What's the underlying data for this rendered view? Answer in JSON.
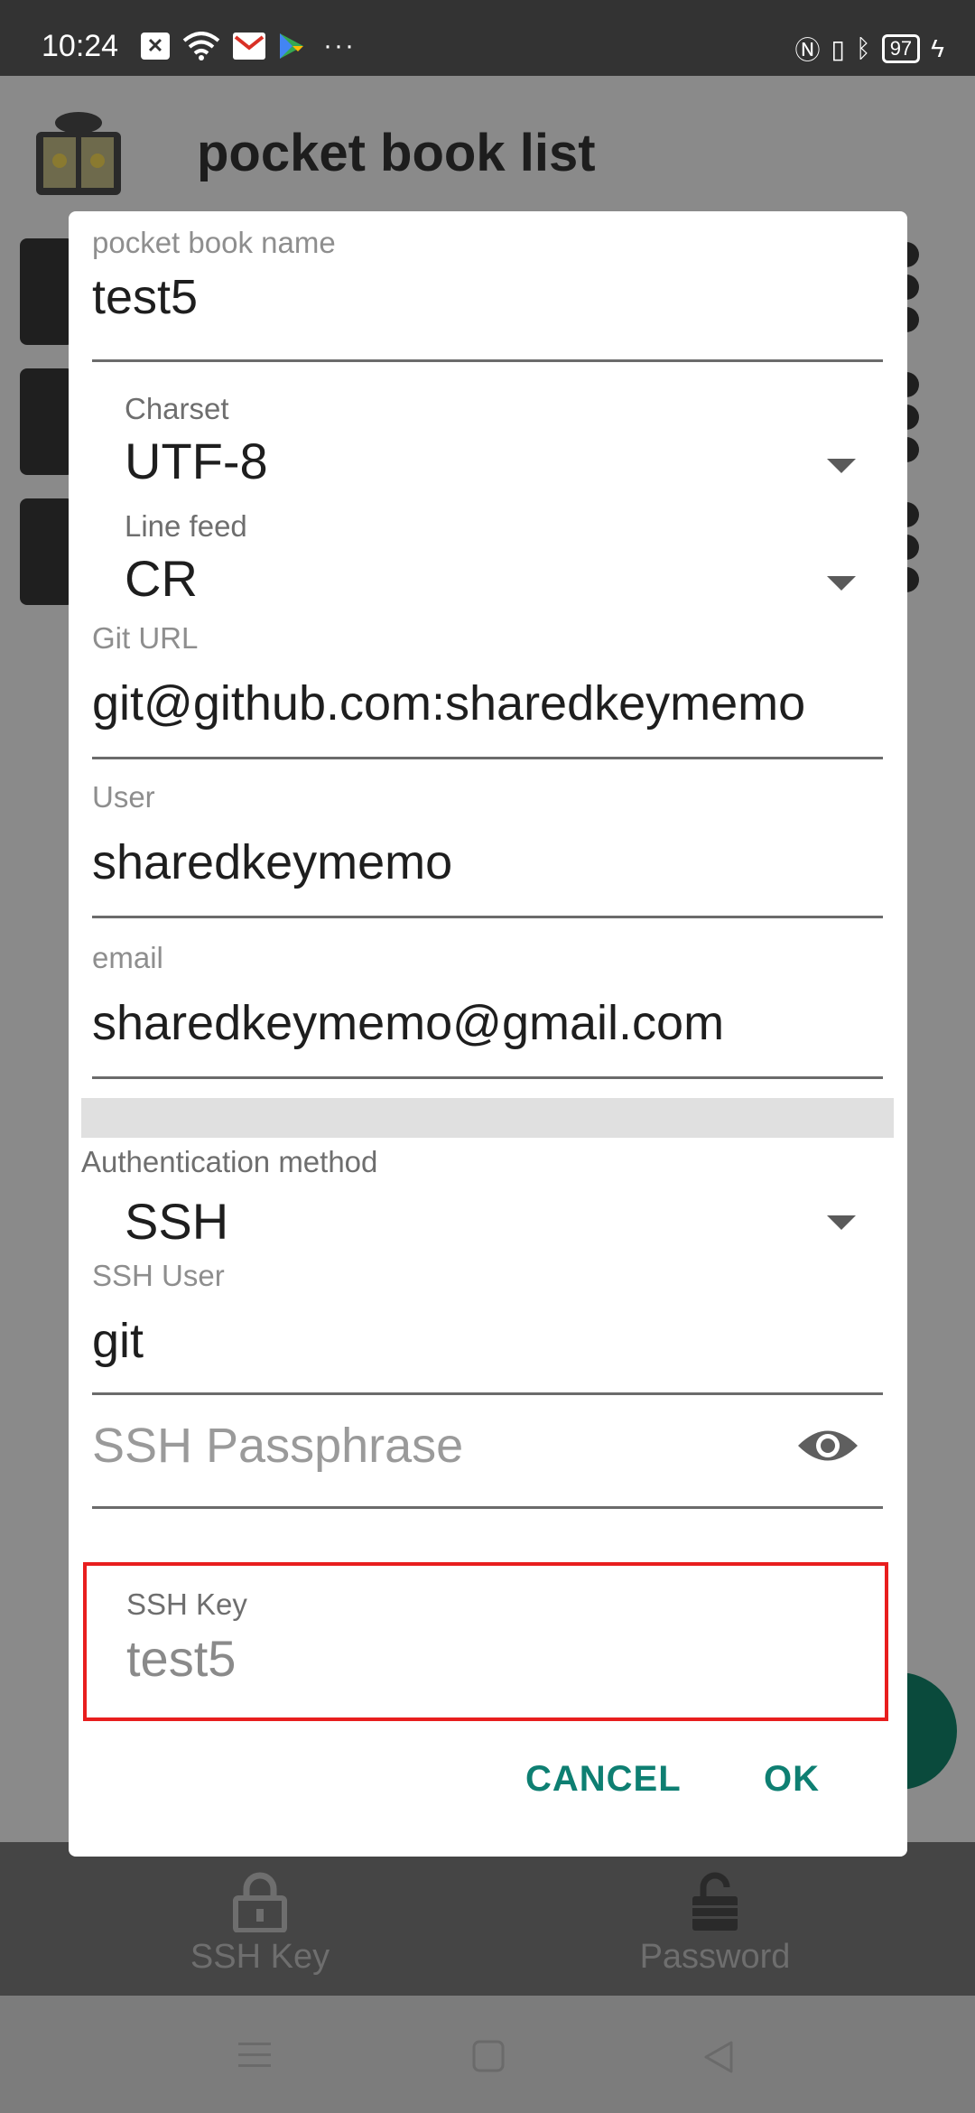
{
  "status_bar": {
    "time": "10:24",
    "battery": "97",
    "overflow": "···"
  },
  "app": {
    "title": "pocket book list",
    "accent_color": "#0e7f72"
  },
  "dialog": {
    "book_name": {
      "label": "pocket book name",
      "value": "test5"
    },
    "charset": {
      "label": "Charset",
      "value": "UTF-8"
    },
    "line_feed": {
      "label": "Line feed",
      "value": "CR"
    },
    "git_url": {
      "label": "Git URL",
      "value": "git@github.com:sharedkeymemo"
    },
    "user": {
      "label": "User",
      "value": "sharedkeymemo"
    },
    "email": {
      "label": "email",
      "value": "sharedkeymemo@gmail.com"
    },
    "auth_method": {
      "label": "Authentication method",
      "value": "SSH"
    },
    "ssh_user": {
      "label": "SSH User",
      "value": "git"
    },
    "ssh_passphrase": {
      "placeholder": "SSH Passphrase",
      "value": ""
    },
    "ssh_key": {
      "label": "SSH Key",
      "value": "test5"
    },
    "cancel_label": "CANCEL",
    "ok_label": "OK"
  },
  "bottom_nav": {
    "items": [
      {
        "label": "SSH Key",
        "icon": "lock-icon"
      },
      {
        "label": "Password",
        "icon": "unlock-icon"
      }
    ]
  },
  "icons": [
    "book-lock-icon",
    "eye-icon",
    "dropdown-caret-icon",
    "menu-icon",
    "home-icon",
    "back-icon"
  ]
}
